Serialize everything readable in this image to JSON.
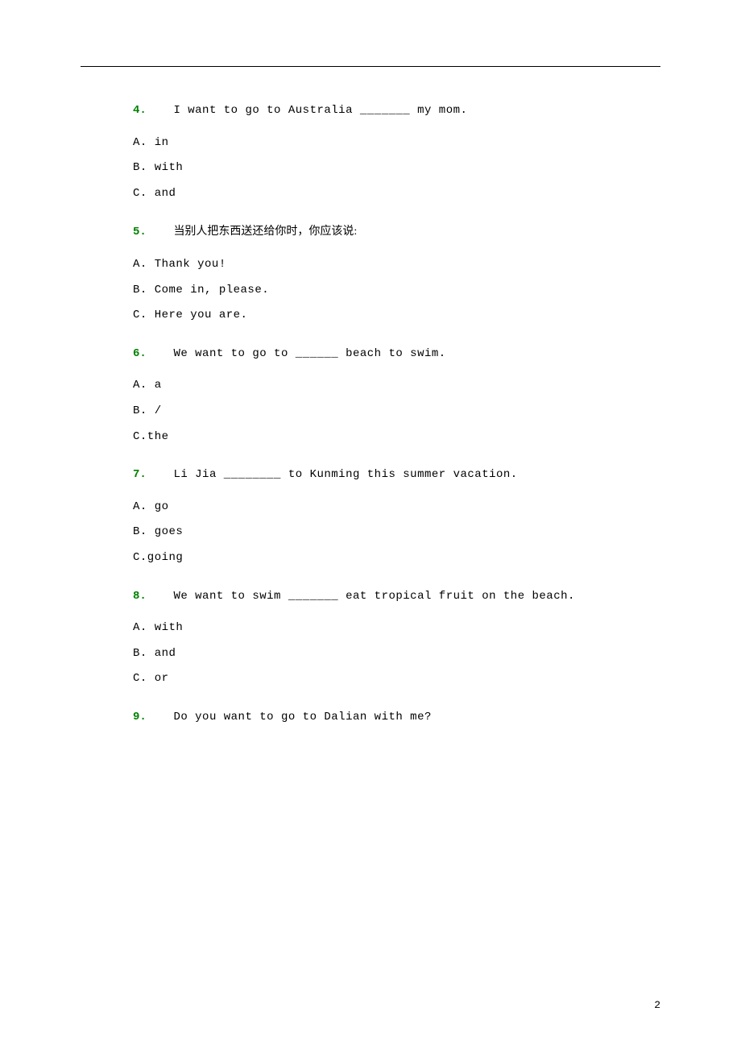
{
  "questions": [
    {
      "number": "4.",
      "text": "I want to go to Australia _______ my mom.",
      "options": [
        "A. in",
        "B. with",
        "C. and"
      ]
    },
    {
      "number": "5.",
      "text": "当别人把东西送还给你时，你应该说:",
      "is_cn": true,
      "options": [
        "A. Thank you!",
        "B. Come in, please.",
        "C. Here you are."
      ]
    },
    {
      "number": "6.",
      "text": "We want to go to ______ beach to swim.",
      "options": [
        "A. a",
        "B. /",
        "C.the"
      ]
    },
    {
      "number": "7.",
      "text": "Li Jia ________ to Kunming this summer vacation.",
      "options": [
        "A. go",
        "B. goes",
        "C.going"
      ]
    },
    {
      "number": "8.",
      "text": "We want to swim _______ eat tropical fruit on the beach.",
      "options": [
        "A. with",
        "B. and",
        "C. or"
      ]
    },
    {
      "number": "9.",
      "text": "Do you want to go to Dalian with me?",
      "options": []
    }
  ],
  "page_number": "2"
}
